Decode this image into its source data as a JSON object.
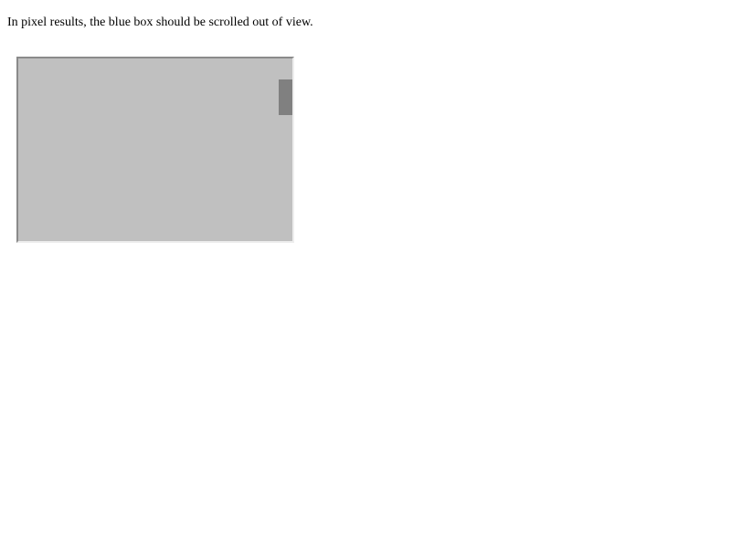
{
  "instruction": {
    "text": "In pixel results, the blue box should be scrolled out of view."
  },
  "scroll_area": {
    "scroll_position_fraction": 0.12,
    "background_color": "#c0c0c0",
    "thumb_color": "#808080"
  }
}
